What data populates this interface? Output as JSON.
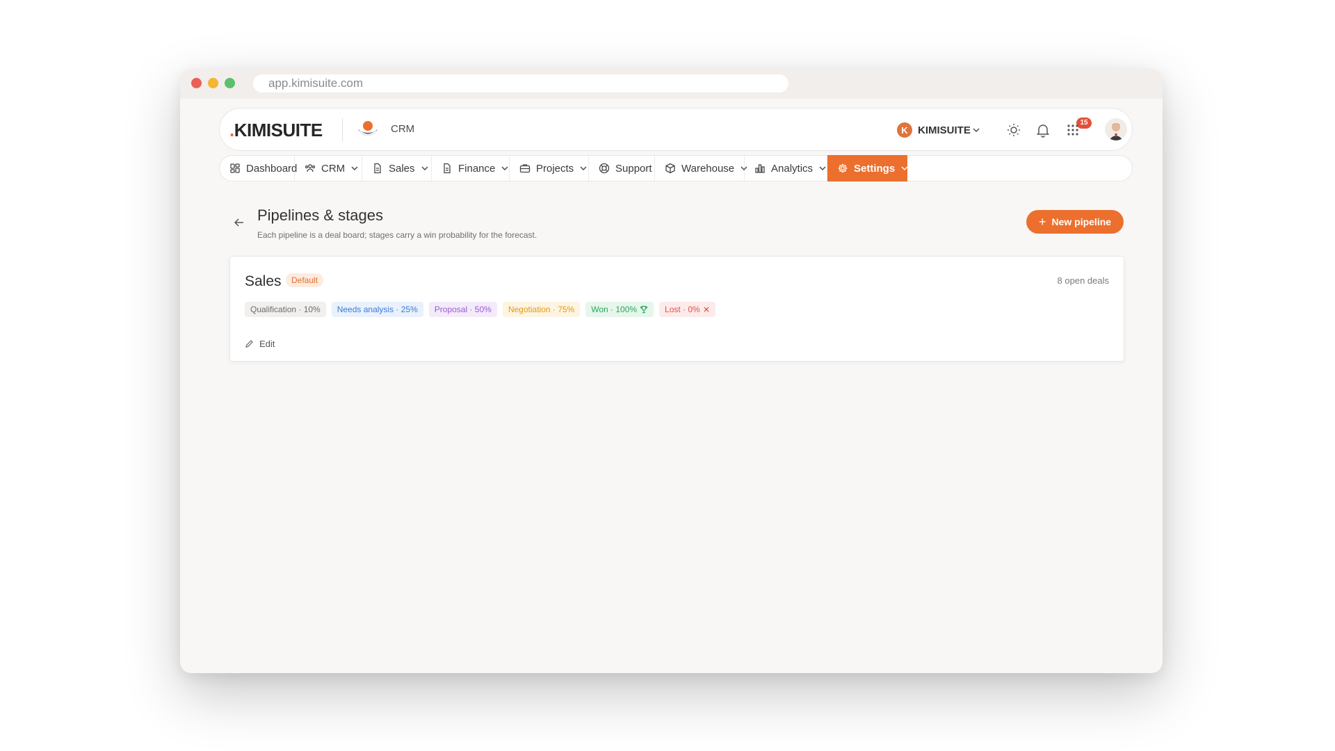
{
  "browser": {
    "url": "app.kimisuite.com"
  },
  "topbar": {
    "logo_dot": ".",
    "logo_text": "KIMISUITE",
    "app_name": "CRM",
    "workspace_initial": "K",
    "workspace_name": "KIMISUITE",
    "notification_count": "15"
  },
  "nav": {
    "items": [
      {
        "label": "Dashboard",
        "icon": "dashboard-icon"
      },
      {
        "label": "CRM",
        "icon": "users-icon"
      },
      {
        "label": "Sales",
        "icon": "document-icon"
      },
      {
        "label": "Finance",
        "icon": "document-icon"
      },
      {
        "label": "Projects",
        "icon": "briefcase-icon"
      },
      {
        "label": "Support",
        "icon": "lifebuoy-icon"
      },
      {
        "label": "Warehouse",
        "icon": "box-icon"
      },
      {
        "label": "Analytics",
        "icon": "bar-chart-icon"
      },
      {
        "label": "Settings",
        "icon": "gear-icon"
      }
    ],
    "active": "Settings"
  },
  "page": {
    "title": "Pipelines & stages",
    "subtitle": "Each pipeline is a deal board; stages carry a win probability for the forecast.",
    "new_button": "New pipeline"
  },
  "pipeline": {
    "name": "Sales",
    "badge": "Default",
    "open_deals": "8 open deals",
    "stages": [
      {
        "label": "Qualification · 10%",
        "color": "#6b6b6b",
        "bg": "#f1f0ee"
      },
      {
        "label": "Needs analysis · 25%",
        "color": "#3a7bd5",
        "bg": "#e9f1fc"
      },
      {
        "label": "Proposal · 50%",
        "color": "#9b59d0",
        "bg": "#f3ebfb"
      },
      {
        "label": "Negotiation · 75%",
        "color": "#e39a12",
        "bg": "#fdf4e1"
      },
      {
        "label": "Won · 100%",
        "color": "#2aa65a",
        "bg": "#e6f6ec",
        "icon": "trophy-icon"
      },
      {
        "label": "Lost · 0%",
        "color": "#e0504a",
        "bg": "#fdeaea",
        "icon": "close-icon"
      }
    ],
    "edit_label": "Edit"
  }
}
